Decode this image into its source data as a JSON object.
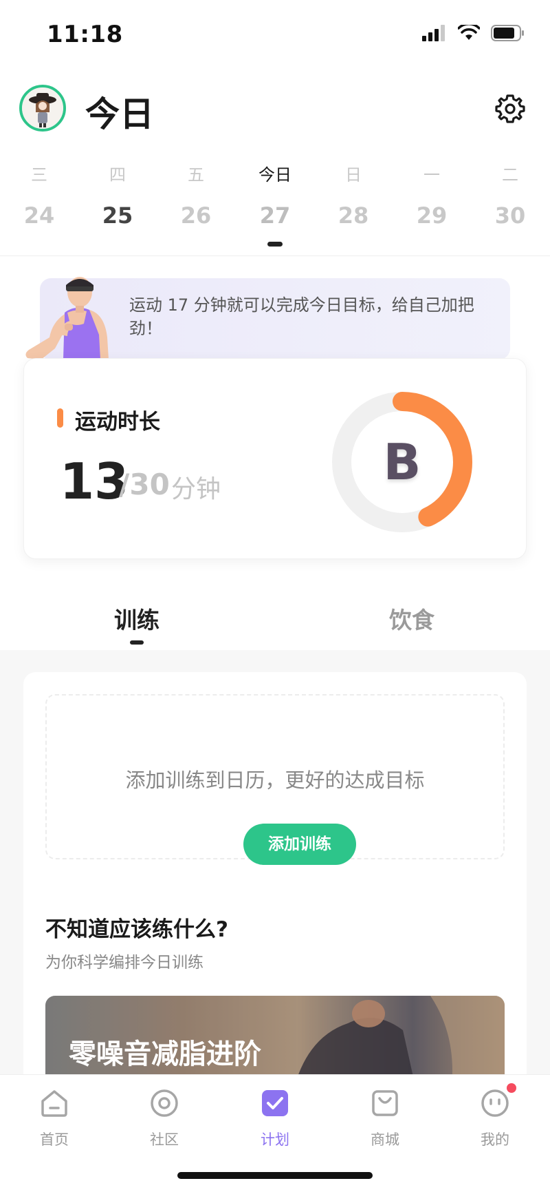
{
  "status_bar": {
    "time": "11:18"
  },
  "header": {
    "title": "今日",
    "avatar_icon": "avatar-icon",
    "settings_icon": "gear-icon"
  },
  "week": {
    "days": [
      {
        "name": "三",
        "date": "24"
      },
      {
        "name": "四",
        "date": "25"
      },
      {
        "name": "五",
        "date": "26"
      },
      {
        "name": "今日",
        "date": "27"
      },
      {
        "name": "日",
        "date": "28"
      },
      {
        "name": "一",
        "date": "29"
      },
      {
        "name": "二",
        "date": "30"
      }
    ]
  },
  "tip": {
    "text": "运动 17 分钟就可以完成今日目标，给自己加把劲！"
  },
  "goal": {
    "label": "运动时长",
    "current": "13",
    "total": "/30",
    "unit": "分钟",
    "grade": "B",
    "progress_fraction": 0.43,
    "accent_color": "#fb8c46"
  },
  "tabs": {
    "train": "训练",
    "food": "饮食"
  },
  "training": {
    "empty_text": "添加训练到日历，更好的达成目标",
    "add_button": "添加训练",
    "suggest_title": "不知道应该练什么?",
    "suggest_subtitle": "为你科学编排今日训练",
    "program_title": "零噪音减脂进阶"
  },
  "bottom_nav": {
    "items": [
      {
        "label": "首页",
        "icon": "home-icon"
      },
      {
        "label": "社区",
        "icon": "community-icon"
      },
      {
        "label": "计划",
        "icon": "plan-check-icon"
      },
      {
        "label": "商城",
        "icon": "shop-bag-icon"
      },
      {
        "label": "我的",
        "icon": "profile-icon"
      }
    ],
    "active_color": "#8c73f0",
    "brand_green": "#2dc58a"
  }
}
